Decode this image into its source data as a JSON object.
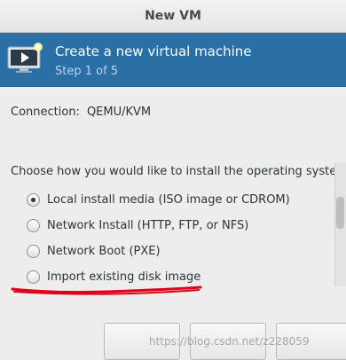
{
  "window": {
    "title": "New VM"
  },
  "header": {
    "title": "Create a new virtual machine",
    "step": "Step 1 of 5",
    "icon": "vm-monitor-icon"
  },
  "connection": {
    "label": "Connection:",
    "value": "QEMU/KVM"
  },
  "install": {
    "question": "Choose how you would like to install the operating system",
    "options": [
      {
        "label": "Local install media (ISO image or CDROM)",
        "selected": true
      },
      {
        "label": "Network Install (HTTP, FTP, or NFS)",
        "selected": false
      },
      {
        "label": "Network Boot (PXE)",
        "selected": false
      },
      {
        "label": "Import existing disk image",
        "selected": false
      }
    ]
  },
  "watermark": "https://blog.csdn.net/z228059",
  "colors": {
    "header_bg": "#2a70a7",
    "annotation": "#e0001a"
  }
}
